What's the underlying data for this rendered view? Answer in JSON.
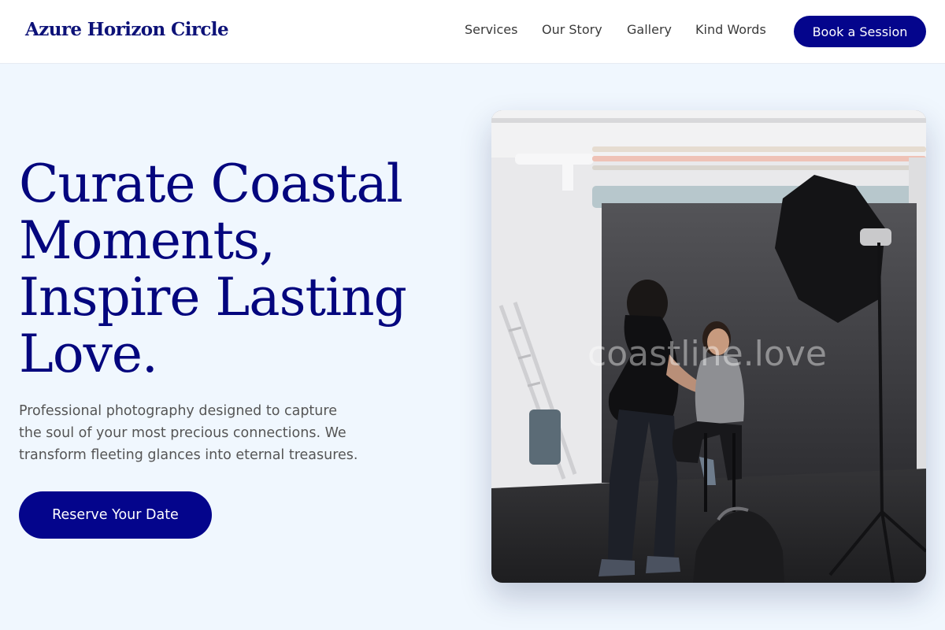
{
  "header": {
    "brand": "Azure Horizon Circle",
    "nav": [
      "Services",
      "Our Story",
      "Gallery",
      "Kind Words"
    ],
    "cta_label": "Book a Session"
  },
  "hero": {
    "title_lines": [
      "Curate Coastal",
      "Moments,",
      "Inspire Lasting",
      "Love."
    ],
    "description_lines": [
      "Professional photography designed to capture",
      "the soul of your most precious connections. We",
      "transform fleeting glances into eternal treasures."
    ],
    "cta_label": "Reserve Your Date"
  },
  "photo": {
    "watermark": "coastline.love"
  },
  "colors": {
    "accent": "#04058c",
    "background": "#f0f7fe",
    "title": "#04067e"
  }
}
